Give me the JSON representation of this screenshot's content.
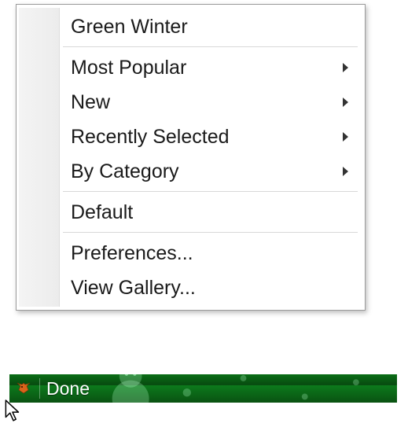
{
  "menu": {
    "items": [
      {
        "label": "Green Winter",
        "submenu": false
      },
      {
        "label": "Most Popular",
        "submenu": true
      },
      {
        "label": "New",
        "submenu": true
      },
      {
        "label": "Recently Selected",
        "submenu": true
      },
      {
        "label": "By Category",
        "submenu": true
      },
      {
        "label": "Default",
        "submenu": false
      },
      {
        "label": "Preferences...",
        "submenu": false
      },
      {
        "label": "View Gallery...",
        "submenu": false
      }
    ]
  },
  "statusbar": {
    "icon": "fox-icon",
    "text": "Done"
  },
  "colors": {
    "statusbar_green": "#0a6e16",
    "menu_border": "#9a9a9a"
  }
}
